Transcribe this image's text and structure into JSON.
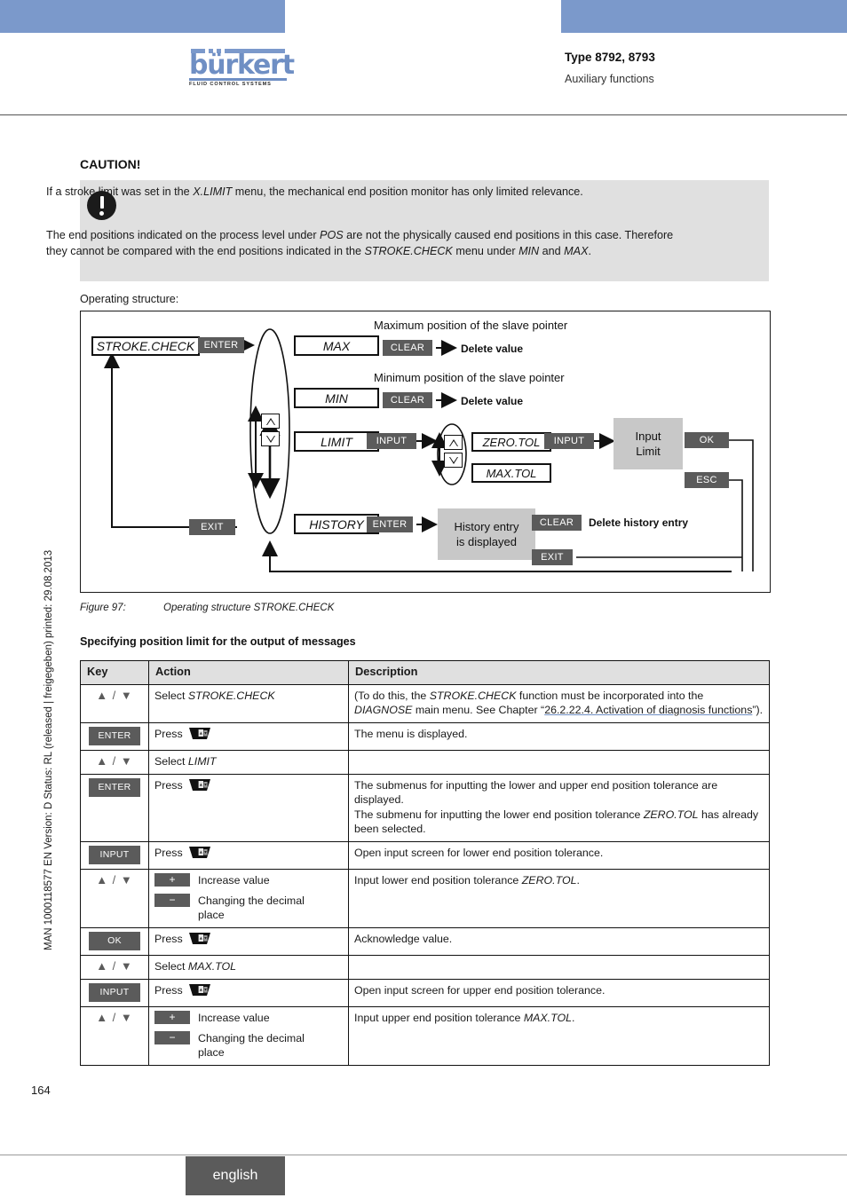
{
  "header": {
    "logo_word": "bürkert",
    "logo_sub": "FLUID CONTROL SYSTEMS",
    "type_line": "Type 8792, 8793",
    "sub_line": "Auxiliary functions"
  },
  "side_text": "MAN 1000118577  EN  Version: D  Status: RL (released | freigegeben)  printed: 29.08.2013",
  "caution": {
    "title": "CAUTION!",
    "paragraph1_a": "If a stroke limit was set in the ",
    "paragraph1_it": "X.LIMIT",
    "paragraph1_b": " menu, the mechanical end position monitor has only limited relevance.",
    "paragraph2_a": "The end positions indicated on the process level under ",
    "paragraph2_it1": "POS",
    "paragraph2_b": " are not the physically caused end positions in this case. Therefore they cannot be compared with the end positions indicated in the ",
    "paragraph2_it2": "STROKE.CHECK",
    "paragraph2_c": " menu under ",
    "paragraph2_it3": "MIN",
    "paragraph2_d": " and ",
    "paragraph2_it4": "MAX",
    "paragraph2_e": "."
  },
  "operating_structure_label": "Operating structure:",
  "diagram": {
    "root": "STROKE.CHECK",
    "enter_key": "ENTER",
    "exit_key": "EXIT",
    "items": {
      "max": "MAX",
      "min": "MIN",
      "limit": "LIMIT",
      "history": "HISTORY"
    },
    "clear_key": "CLEAR",
    "input_key": "INPUT",
    "ok_key": "OK",
    "esc_key": "ESC",
    "max_caption": "Maximum position of the slave pointer",
    "min_caption": "Minimum position of the slave pointer",
    "delete_value": "Delete value",
    "zero_tol": "ZERO.TOL",
    "max_tol": "MAX.TOL",
    "input_limit_line1": "Input",
    "input_limit_line2": "Limit",
    "history_box_line1": "History entry",
    "history_box_line2": "is displayed",
    "delete_history": "Delete history entry"
  },
  "figure": {
    "number": "Figure 97:",
    "caption": "Operating structure STROKE.CHECK"
  },
  "section_title": "Specifying position limit for the output of messages",
  "table": {
    "headers": [
      "Key",
      "Action",
      "Description"
    ],
    "rows": [
      {
        "key_type": "updown",
        "key": "▲ / ▼",
        "action_prefix": "Select ",
        "action_italic": "STROKE.CHECK",
        "desc_type": "link",
        "desc_a": "(To do this, the ",
        "desc_it1": "STROKE.CHECK",
        "desc_b": " function must be incorporated into the ",
        "desc_it2": "DIAGNOSE",
        "desc_c": " main menu. See Chapter “",
        "desc_link": "26.2.22.4. Activation of diagnosis functions",
        "desc_d": "”)."
      },
      {
        "key_type": "badge",
        "key": "ENTER",
        "action_prefix": "Press ",
        "action_italic": "",
        "action_icon": "press-key-icon",
        "desc_type": "plain",
        "desc_a": "The menu is displayed."
      },
      {
        "key_type": "updown",
        "key": "▲ / ▼",
        "action_prefix": "Select ",
        "action_italic": "LIMIT",
        "desc_type": "plain",
        "desc_a": ""
      },
      {
        "key_type": "badge",
        "key": "ENTER",
        "action_prefix": "Press ",
        "action_italic": "",
        "action_icon": "press-key-icon",
        "desc_type": "italic-tail",
        "desc_a": "The submenus for inputting the lower and upper end position tolerance are displayed.",
        "desc_b": "The submenu for inputting the lower end position tolerance ",
        "desc_it1": "ZERO.TOL",
        "desc_c": " has already been selected."
      },
      {
        "key_type": "badge",
        "key": "INPUT",
        "action_prefix": "Press ",
        "action_italic": "",
        "action_icon": "press-key-icon",
        "desc_type": "plain",
        "desc_a": "Open input screen for lower end position tolerance."
      },
      {
        "key_type": "updown",
        "key": "▲ / ▼",
        "action_type": "plusminus",
        "plus_label": "+",
        "plus_text": "Increase value",
        "minus_label": "−",
        "minus_text": "Changing the decimal place",
        "desc_type": "italic-mid",
        "desc_a": "Input lower end position tolerance ",
        "desc_it1": "ZERO.TOL",
        "desc_b": "."
      },
      {
        "key_type": "badge",
        "key": "OK",
        "action_prefix": "Press ",
        "action_italic": "",
        "action_icon": "press-key-icon",
        "desc_type": "plain",
        "desc_a": "Acknowledge value."
      },
      {
        "key_type": "updown",
        "key": "▲ / ▼",
        "action_prefix": "Select ",
        "action_italic": "MAX.TOL",
        "desc_type": "plain",
        "desc_a": ""
      },
      {
        "key_type": "badge",
        "key": "INPUT",
        "action_prefix": "Press ",
        "action_italic": "",
        "action_icon": "press-key-icon",
        "desc_type": "plain",
        "desc_a": "Open input screen for upper end position tolerance."
      },
      {
        "key_type": "updown",
        "key": "▲ / ▼",
        "action_type": "plusminus",
        "plus_label": "+",
        "plus_text": "Increase value",
        "minus_label": "−",
        "minus_text": "Changing the decimal place",
        "desc_type": "italic-mid",
        "desc_a": "Input upper end position tolerance ",
        "desc_it1": "MAX.TOL",
        "desc_b": "."
      }
    ]
  },
  "footer": {
    "page_number": "164",
    "language_tab": "english"
  },
  "colors": {
    "brand_blue": "#7b99cb",
    "key_badge": "#5b5b5b",
    "panel_gray": "#e0e0e0",
    "diagram_gray": "#c8c8c8"
  }
}
